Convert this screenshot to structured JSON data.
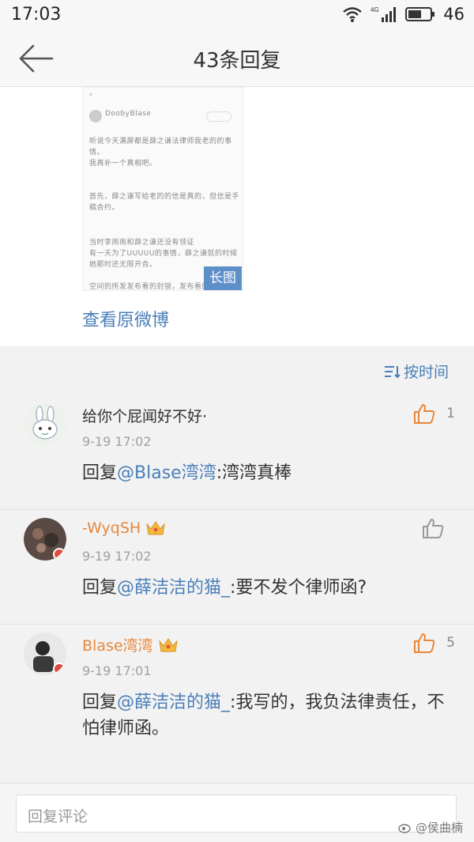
{
  "status": {
    "time": "17:03",
    "network": "4G",
    "battery": "46"
  },
  "nav": {
    "title": "43条回复"
  },
  "post": {
    "thumb_lines": [
      "DoobyBlase",
      "听说今天满屏都是薛之谦法律师我老的的事",
      "情。",
      "我再补一个真相吧。",
      "首先，薛之谦写给老的的信是真的，但信是手",
      "稿合约。",
      "当时李雨雨和薛之谦还没有领证",
      "有一天为了UUUUU的事情，薛之谦就的时候",
      "她那时还无限开合。",
      "空间的所发发布看的封锁，发布看的"
    ],
    "long_image_label": "长图",
    "view_original": "查看原微博"
  },
  "sort": {
    "label": "按时间"
  },
  "comments": [
    {
      "name": "给你个屁闻好不好·",
      "time": "9-19 17:02",
      "prefix": "回复",
      "at": "@Blase湾湾",
      "text": ":湾湾真棒",
      "likes": "1",
      "liked": true,
      "name_color": "#333333",
      "crown": false
    },
    {
      "name": "-WyqSH",
      "time": "9-19 17:02",
      "prefix": "回复",
      "at": "@薛洁洁的猫_",
      "text": ":要不发个律师函?",
      "likes": "",
      "liked": false,
      "name_color": "#e8873a",
      "crown": true
    },
    {
      "name": "Blase湾湾",
      "time": "9-19 17:01",
      "prefix": "回复",
      "at": "@薛洁洁的猫_",
      "text": ":我写的，我负法律责任，不怕律师函。",
      "likes": "5",
      "liked": true,
      "name_color": "#e8873a",
      "crown": true
    }
  ],
  "reply_bar": {
    "placeholder": "回复评论"
  },
  "watermark": "@侯曲楠",
  "colors": {
    "link": "#4a7fb8",
    "accent": "#e8873a",
    "long_image_bg": "#5d8fc9"
  }
}
